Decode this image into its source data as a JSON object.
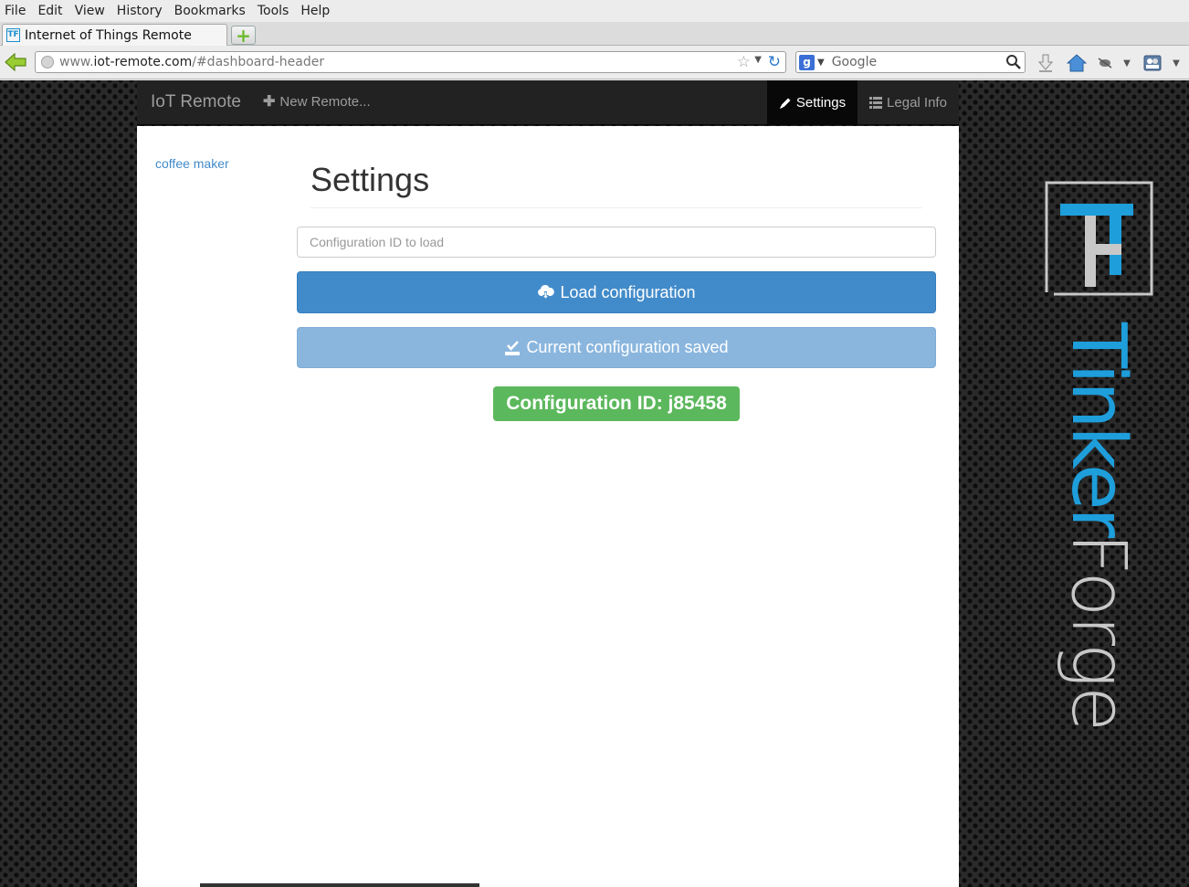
{
  "menubar": {
    "items": [
      "File",
      "Edit",
      "View",
      "History",
      "Bookmarks",
      "Tools",
      "Help"
    ]
  },
  "tabs": [
    {
      "title": "Internet of Things Remote",
      "favicon": "TF"
    }
  ],
  "address": {
    "host": "www.iot-remote.com",
    "hash": "/#dashboard-header",
    "host_prefix": "www.",
    "host_main": "iot-remote.com"
  },
  "search": {
    "placeholder": "Google",
    "engine_icon": "g"
  },
  "app": {
    "brand": "IoT Remote",
    "new_remote": "New Remote...",
    "settings_tab": "Settings",
    "legal_tab": "Legal Info",
    "sidebar": {
      "items": [
        "coffee maker"
      ]
    },
    "title": "Settings",
    "config_input_placeholder": "Configuration ID to load",
    "load_button": "Load configuration",
    "saved_button": "Current configuration saved",
    "config_id_label": "Configuration ID: j85458"
  },
  "logo": {
    "mark": "TF",
    "word_first": "Tinker",
    "word_second": "Forge",
    "accent": "#1e9edb",
    "secondary": "#c8c8c8"
  },
  "colors": {
    "primary": "#428bca",
    "success": "#5cb85c",
    "navbar": "#222222"
  }
}
